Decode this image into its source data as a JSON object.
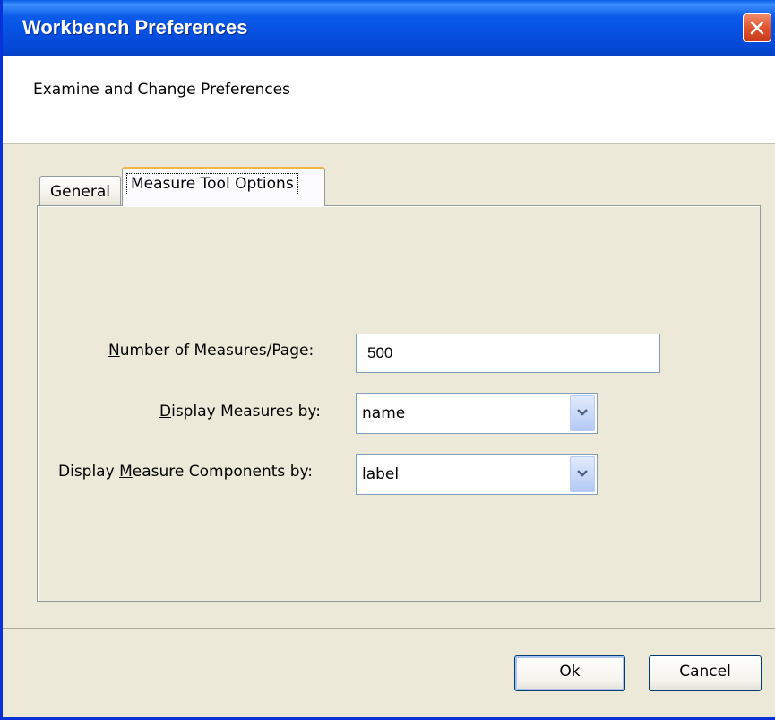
{
  "window": {
    "title": "Workbench Preferences",
    "header": "Examine and Change Preferences"
  },
  "tabs": [
    {
      "label": "General",
      "selected": false
    },
    {
      "label": "Measure Tool Options",
      "selected": true
    }
  ],
  "form": {
    "measures_per_page": {
      "label": "Number of Measures/Page:",
      "mnemonic": "N",
      "value": "500"
    },
    "display_measures_by": {
      "label": "Display Measures by:",
      "mnemonic": "D",
      "value": "name"
    },
    "display_components_by": {
      "label": "Display Measure Components by:",
      "mnemonic": "M",
      "value": "label"
    }
  },
  "buttons": {
    "ok": "Ok",
    "cancel": "Cancel"
  },
  "colors": {
    "titlebar": "#0553e4",
    "close_button": "#e2542f",
    "tab_highlight": "#f5b445",
    "dialog_bg": "#ece9d8"
  },
  "icons": {
    "close": "close-icon",
    "dropdown": "chevron-down-icon"
  }
}
